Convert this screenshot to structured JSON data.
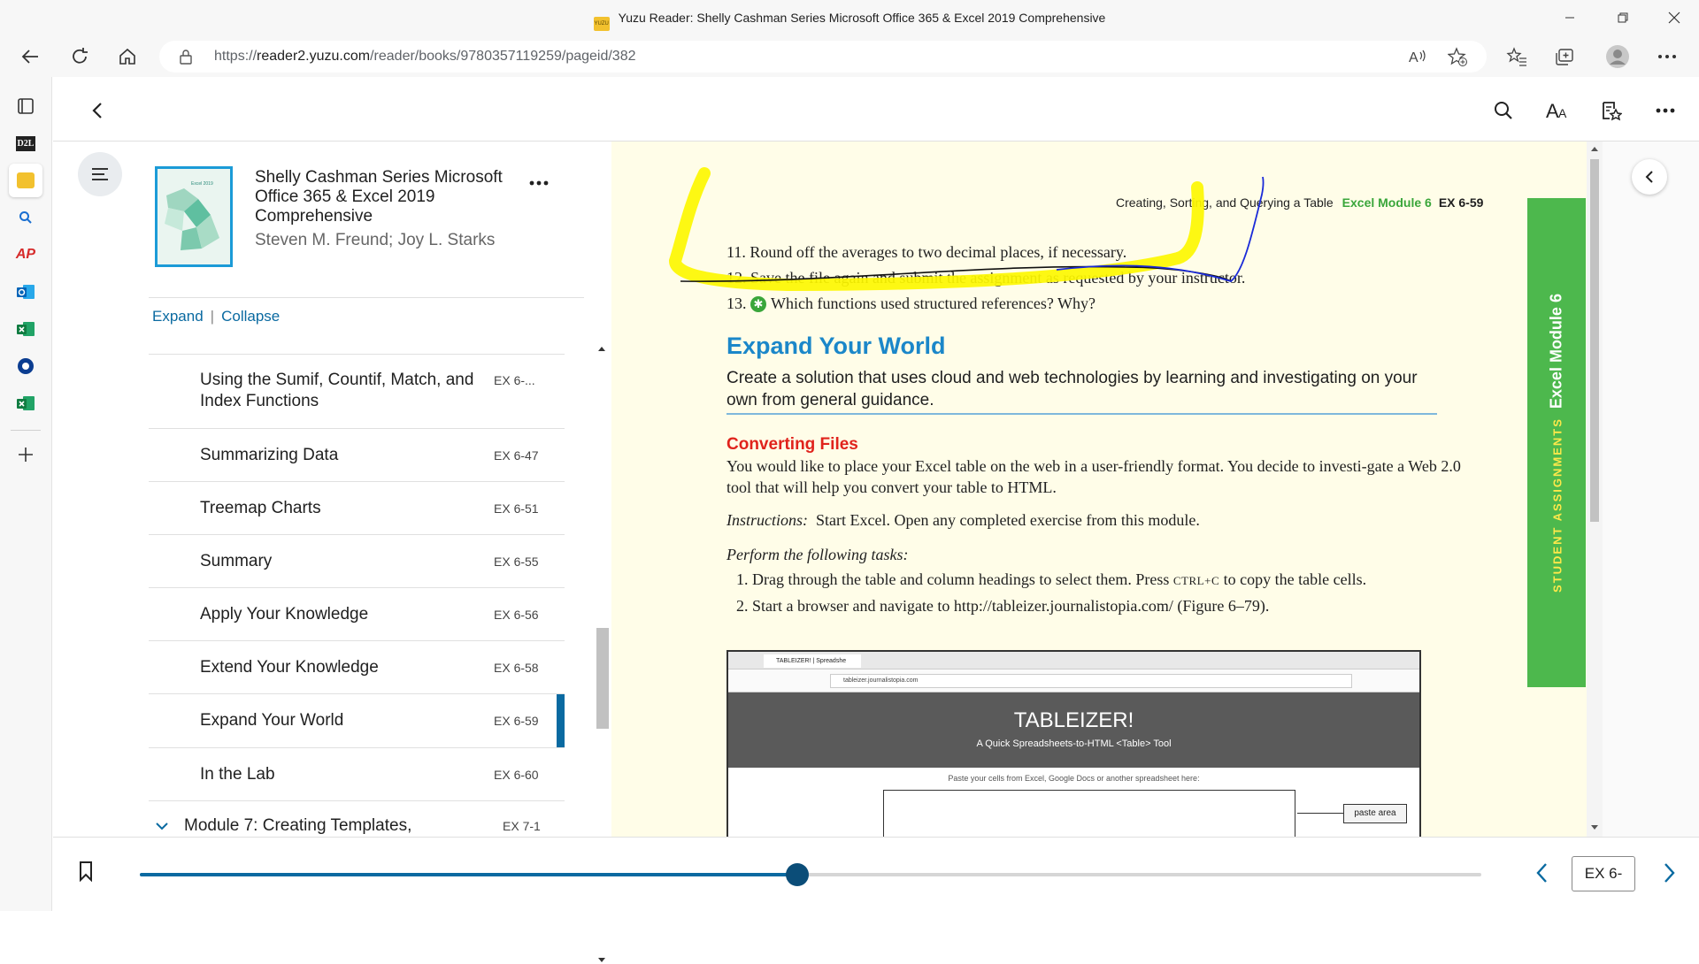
{
  "window": {
    "title": "Yuzu Reader: Shelly Cashman Series Microsoft Office 365 & Excel 2019 Comprehensive",
    "favicon_text": "YUZU"
  },
  "browser": {
    "url_prefix": "https://",
    "url_host": "reader2.yuzu.com",
    "url_path": "/reader/books/9780357119259/pageid/382"
  },
  "edge_sidebar": {
    "d2l_label": "D2L",
    "ap_label": "AP"
  },
  "toc": {
    "book_title": "Shelly Cashman Series Microsoft Office 365 & Excel 2019 Comprehensive",
    "book_authors": "Steven M. Freund; Joy L. Starks",
    "cover_label": "Excel 2019",
    "expand_label": "Expand",
    "separator": "|",
    "collapse_label": "Collapse",
    "items": [
      {
        "label": "Using the Sumif, Countif, Match, and Index Functions",
        "page": "EX 6-..."
      },
      {
        "label": "Summarizing Data",
        "page": "EX 6-47"
      },
      {
        "label": "Treemap Charts",
        "page": "EX 6-51"
      },
      {
        "label": "Summary",
        "page": "EX 6-55"
      },
      {
        "label": "Apply Your Knowledge",
        "page": "EX 6-56"
      },
      {
        "label": "Extend Your Knowledge",
        "page": "EX 6-58"
      },
      {
        "label": "Expand Your World",
        "page": "EX 6-59"
      },
      {
        "label": "In the Lab",
        "page": "EX 6-60"
      },
      {
        "label": "Module 7: Creating Templates,",
        "page": "EX 7-1"
      }
    ],
    "active_index": 6
  },
  "page": {
    "running_head": "Creating, Sorting, and Querying a Table",
    "module_label": "Excel Module 6",
    "page_number": "EX 6-59",
    "steps": [
      {
        "num": "11.",
        "text": "Round off the averages to two decimal places, if necessary."
      },
      {
        "num": "12.",
        "text": "Save the file again and submit the assignment as requested by your instructor."
      },
      {
        "num": "13.",
        "text": "Which functions used structured references? Why?"
      }
    ],
    "heading": "Expand Your World",
    "intro": "Create a solution that uses cloud and web technologies by learning and investigating on your own from general guidance.",
    "subheading": "Converting Files",
    "body": "You would like to place your Excel table on the web in a user-friendly format. You decide to investi-gate a Web 2.0 tool that will help you convert your table to HTML.",
    "instructions_label": "Instructions:",
    "instructions_text": "Start Excel. Open any completed exercise from this module.",
    "perform_label": "Perform the following tasks:",
    "tasks": [
      {
        "num": "1.",
        "pre": "Drag through the table and column headings to select them. Press ",
        "key": "CTRL+C",
        "post": " to copy the table cells."
      },
      {
        "num": "2.",
        "pre": "Start a browser and navigate to http://tableizer.journalistopia.com/ (Figure 6–79).",
        "key": "",
        "post": ""
      }
    ],
    "side_tab_label": "STUDENT ASSIGNMENTS",
    "side_tab_module": "Excel Module 6",
    "figure": {
      "tab_label": "TABLEIZER! | Spreadshe",
      "url": "tableizer.journalistopia.com",
      "title": "TABLEIZER!",
      "subtitle": "A Quick Spreadsheets-to-HTML <Table> Tool",
      "paste_note": "Paste your cells from Excel, Google Docs or another spreadsheet here:",
      "callout": "paste area"
    }
  },
  "bottom": {
    "progress": 0.49,
    "page_input": "EX 6-"
  },
  "colors": {
    "accent": "#0a6aa1",
    "heading_blue": "#1b87c9",
    "subheading_red": "#e0231c",
    "module_green": "#3aa63a",
    "tab_green": "#4db84d",
    "highlight_yellow": "#fdf700"
  },
  "icons": {
    "back": "arrow-left-icon",
    "refresh": "refresh-icon",
    "home": "home-icon",
    "lock": "lock-icon",
    "read_aloud": "read-aloud-icon",
    "add_favorite": "star-plus-icon",
    "favorites": "favorites-icon",
    "collections": "collections-icon",
    "profile": "profile-icon",
    "more": "more-icon",
    "search": "search-icon",
    "text_size": "text-size-icon",
    "notes": "notes-icon"
  }
}
